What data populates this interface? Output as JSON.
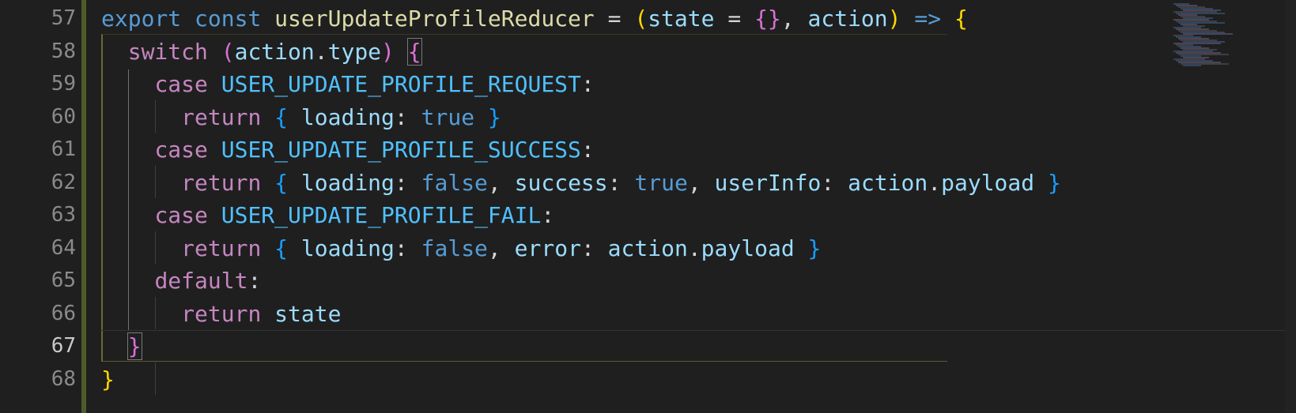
{
  "editor": {
    "line_numbers": [
      "57",
      "58",
      "59",
      "60",
      "61",
      "62",
      "63",
      "64",
      "65",
      "66",
      "67",
      "68"
    ],
    "lines": [
      [
        [
          "kw-blue",
          "export"
        ],
        [
          "punct",
          " "
        ],
        [
          "kw-blue",
          "const"
        ],
        [
          "punct",
          " "
        ],
        [
          "fn",
          "userUpdateProfileReducer"
        ],
        [
          "punct",
          " = "
        ],
        [
          "br-gold",
          "("
        ],
        [
          "var",
          "state"
        ],
        [
          "punct",
          " = "
        ],
        [
          "br-pink",
          "{}"
        ],
        [
          "punct",
          ", "
        ],
        [
          "var",
          "action"
        ],
        [
          "br-gold",
          ")"
        ],
        [
          "punct",
          " "
        ],
        [
          "kw-blue",
          "=>"
        ],
        [
          "punct",
          " "
        ],
        [
          "br-gold",
          "{"
        ]
      ],
      [
        [
          "punct",
          "  "
        ],
        [
          "kw-pink",
          "switch"
        ],
        [
          "punct",
          " "
        ],
        [
          "br-pink",
          "("
        ],
        [
          "var",
          "action"
        ],
        [
          "punct",
          "."
        ],
        [
          "var",
          "type"
        ],
        [
          "br-pink",
          ")"
        ],
        [
          "punct",
          " "
        ],
        [
          "br-pink match",
          "{"
        ]
      ],
      [
        [
          "punct",
          "    "
        ],
        [
          "kw-pink",
          "case"
        ],
        [
          "punct",
          " "
        ],
        [
          "const",
          "USER_UPDATE_PROFILE_REQUEST"
        ],
        [
          "punct",
          ":"
        ]
      ],
      [
        [
          "punct",
          "      "
        ],
        [
          "kw-pink",
          "return"
        ],
        [
          "punct",
          " "
        ],
        [
          "br-blue",
          "{"
        ],
        [
          "punct",
          " "
        ],
        [
          "var",
          "loading"
        ],
        [
          "punct",
          ": "
        ],
        [
          "kw-blue",
          "true"
        ],
        [
          "punct",
          " "
        ],
        [
          "br-blue",
          "}"
        ]
      ],
      [
        [
          "punct",
          "    "
        ],
        [
          "kw-pink",
          "case"
        ],
        [
          "punct",
          " "
        ],
        [
          "const",
          "USER_UPDATE_PROFILE_SUCCESS"
        ],
        [
          "punct",
          ":"
        ]
      ],
      [
        [
          "punct",
          "      "
        ],
        [
          "kw-pink",
          "return"
        ],
        [
          "punct",
          " "
        ],
        [
          "br-blue",
          "{"
        ],
        [
          "punct",
          " "
        ],
        [
          "var",
          "loading"
        ],
        [
          "punct",
          ": "
        ],
        [
          "kw-blue",
          "false"
        ],
        [
          "punct",
          ", "
        ],
        [
          "var",
          "success"
        ],
        [
          "punct",
          ": "
        ],
        [
          "kw-blue",
          "true"
        ],
        [
          "punct",
          ", "
        ],
        [
          "var",
          "userInfo"
        ],
        [
          "punct",
          ": "
        ],
        [
          "var",
          "action"
        ],
        [
          "punct",
          "."
        ],
        [
          "var",
          "payload"
        ],
        [
          "punct",
          " "
        ],
        [
          "br-blue",
          "}"
        ]
      ],
      [
        [
          "punct",
          "    "
        ],
        [
          "kw-pink",
          "case"
        ],
        [
          "punct",
          " "
        ],
        [
          "const",
          "USER_UPDATE_PROFILE_FAIL"
        ],
        [
          "punct",
          ":"
        ]
      ],
      [
        [
          "punct",
          "      "
        ],
        [
          "kw-pink",
          "return"
        ],
        [
          "punct",
          " "
        ],
        [
          "br-blue",
          "{"
        ],
        [
          "punct",
          " "
        ],
        [
          "var",
          "loading"
        ],
        [
          "punct",
          ": "
        ],
        [
          "kw-blue",
          "false"
        ],
        [
          "punct",
          ", "
        ],
        [
          "var",
          "error"
        ],
        [
          "punct",
          ": "
        ],
        [
          "var",
          "action"
        ],
        [
          "punct",
          "."
        ],
        [
          "var",
          "payload"
        ],
        [
          "punct",
          " "
        ],
        [
          "br-blue",
          "}"
        ]
      ],
      [
        [
          "punct",
          "    "
        ],
        [
          "kw-pink",
          "default"
        ],
        [
          "punct",
          ":"
        ]
      ],
      [
        [
          "punct",
          "      "
        ],
        [
          "kw-pink",
          "return"
        ],
        [
          "punct",
          " "
        ],
        [
          "var",
          "state"
        ]
      ],
      [
        [
          "punct",
          "  "
        ],
        [
          "br-pink match",
          "}"
        ]
      ],
      [
        [
          "br-gold",
          "}"
        ]
      ]
    ]
  },
  "colors": {
    "background": "#1f1f1f",
    "keyword_blue": "#569cd6",
    "keyword_pink": "#c586c0",
    "function": "#dcdcaa",
    "variable": "#9cdcfe",
    "constant": "#4fc1ff",
    "bracket_gold": "#ffd700",
    "bracket_pink": "#da70d6",
    "bracket_blue": "#179fff"
  }
}
